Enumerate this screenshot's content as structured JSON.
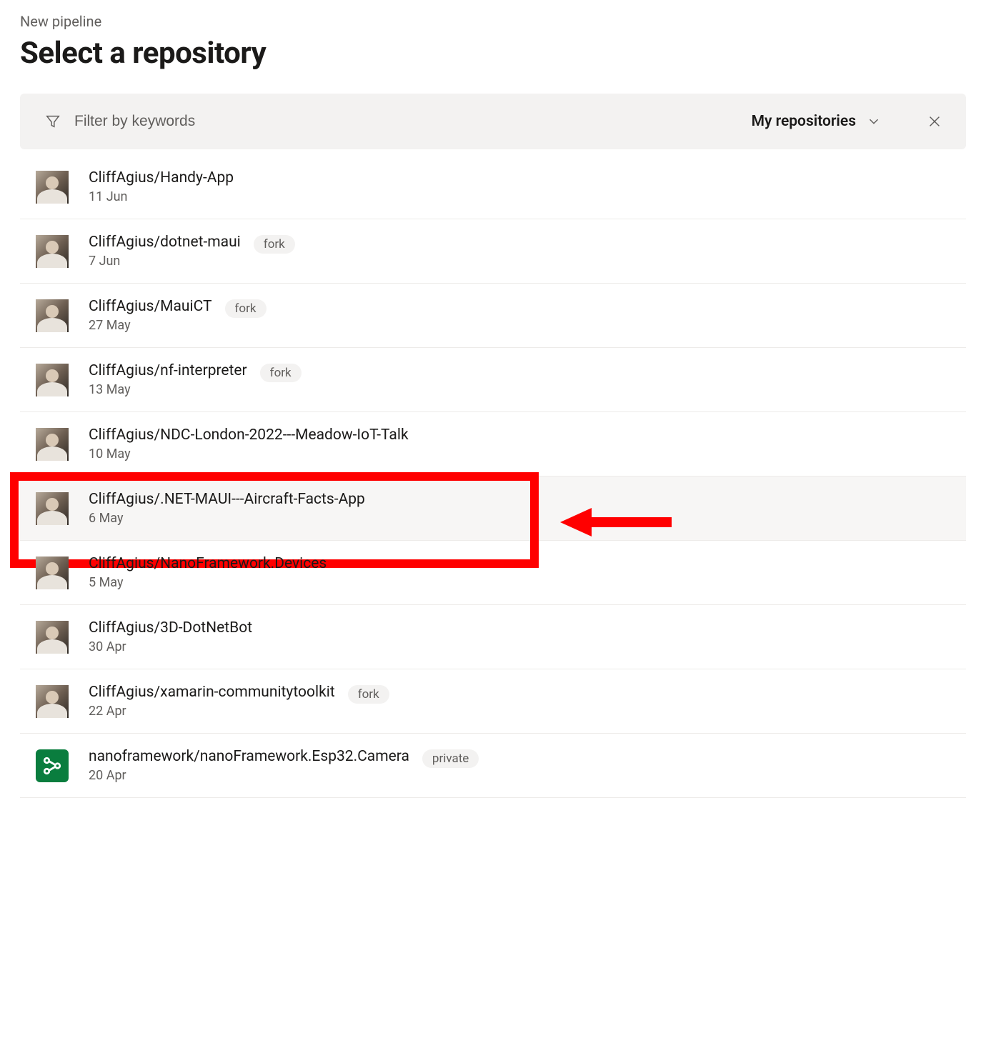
{
  "breadcrumb": "New pipeline",
  "title": "Select a repository",
  "filter": {
    "placeholder": "Filter by keywords",
    "scope_label": "My repositories"
  },
  "badges": {
    "fork": "fork",
    "private": "private"
  },
  "repos": [
    {
      "name": "CliffAgius/Handy-App",
      "date": "11 Jun",
      "badge": null,
      "avatar": "user",
      "highlighted": false
    },
    {
      "name": "CliffAgius/dotnet-maui",
      "date": "7 Jun",
      "badge": "fork",
      "avatar": "user",
      "highlighted": false
    },
    {
      "name": "CliffAgius/MauiCT",
      "date": "27 May",
      "badge": "fork",
      "avatar": "user",
      "highlighted": false
    },
    {
      "name": "CliffAgius/nf-interpreter",
      "date": "13 May",
      "badge": "fork",
      "avatar": "user",
      "highlighted": false
    },
    {
      "name": "CliffAgius/NDC-London-2022---Meadow-IoT-Talk",
      "date": "10 May",
      "badge": null,
      "avatar": "user",
      "highlighted": false
    },
    {
      "name": "CliffAgius/.NET-MAUI---Aircraft-Facts-App",
      "date": "6 May",
      "badge": null,
      "avatar": "user",
      "highlighted": true
    },
    {
      "name": "CliffAgius/NanoFramework.Devices",
      "date": "5 May",
      "badge": null,
      "avatar": "user",
      "highlighted": false
    },
    {
      "name": "CliffAgius/3D-DotNetBot",
      "date": "30 Apr",
      "badge": null,
      "avatar": "user",
      "highlighted": false
    },
    {
      "name": "CliffAgius/xamarin-communitytoolkit",
      "date": "22 Apr",
      "badge": "fork",
      "avatar": "user",
      "highlighted": false
    },
    {
      "name": "nanoframework/nanoFramework.Esp32.Camera",
      "date": "20 Apr",
      "badge": "private",
      "avatar": "org",
      "highlighted": false
    }
  ],
  "annotation": {
    "highlighted_index": 5
  }
}
